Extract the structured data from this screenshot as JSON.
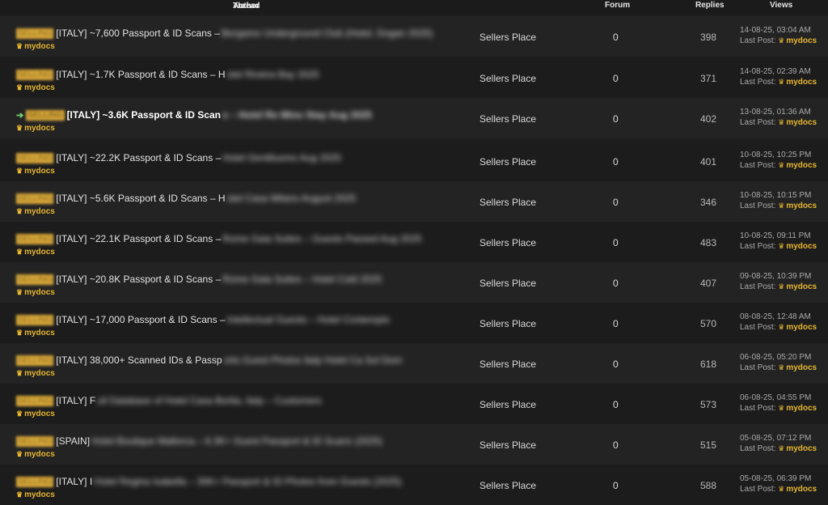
{
  "header": {
    "thread": "Thread",
    "author": "Author",
    "forum": "Forum",
    "replies": "Replies",
    "views": "Views"
  },
  "colors": {
    "accent": "#e8b730",
    "prefix_badge": "#d8a83a",
    "row_odd": "#232323",
    "row_even": "#1c1c1c",
    "new_arrow": "#6fd66f"
  },
  "rows": [
    {
      "prefix": "SELLING",
      "title": "[ITALY] ~7,600 Passport & ID Scans –",
      "hidden": "Bergamo Underground Club (Hotel, Dogan 2025)",
      "author": "mydocs",
      "forum": "Sellers Place",
      "count": "0",
      "replies": "398",
      "date": "14-08-25, 03:04 AM",
      "lp_label": "Last Post:",
      "lp_user": "mydocs"
    },
    {
      "prefix": "SELLING",
      "title": "[ITALY] ~1.7K Passport & ID Scans – H",
      "hidden": "otel Riviera Bay 2025",
      "author": "mydocs",
      "forum": "Sellers Place",
      "count": "0",
      "replies": "371",
      "date": "14-08-25, 02:39 AM",
      "lp_label": "Last Post:",
      "lp_user": "mydocs"
    },
    {
      "prefix": "SELLING",
      "title": "[ITALY] ~3.6K Passport & ID Scan",
      "hidden": "s – Hotel Re Mino Stay Aug 2025",
      "author": "mydocs",
      "forum": "Sellers Place",
      "count": "0",
      "replies": "402",
      "date": "13-08-25, 01:36 AM",
      "lp_label": "Last Post:",
      "lp_user": "mydocs"
    },
    {
      "prefix": "SELLING",
      "title": "[ITALY] ~22.2K Passport & ID Scans –",
      "hidden": "Hotel Gentiluomo Aug 2025",
      "author": "mydocs",
      "forum": "Sellers Place",
      "count": "0",
      "replies": "401",
      "date": "10-08-25, 10:25 PM",
      "lp_label": "Last Post:",
      "lp_user": "mydocs"
    },
    {
      "prefix": "SELLING",
      "title": "[ITALY] ~5.6K Passport & ID Scans – H",
      "hidden": "otel Casa Milano August 2025",
      "author": "mydocs",
      "forum": "Sellers Place",
      "count": "0",
      "replies": "346",
      "date": "10-08-25, 10:15 PM",
      "lp_label": "Last Post:",
      "lp_user": "mydocs"
    },
    {
      "prefix": "SELLING",
      "title": "[ITALY] ~22.1K Passport & ID Scans –",
      "hidden": "Rome Gaia Suites – Guests Passed Aug 2025",
      "author": "mydocs",
      "forum": "Sellers Place",
      "count": "0",
      "replies": "483",
      "date": "10-08-25, 09:11 PM",
      "lp_label": "Last Post:",
      "lp_user": "mydocs"
    },
    {
      "prefix": "SELLING",
      "title": "[ITALY] ~20.8K Passport & ID Scans –",
      "hidden": "Rome Gaia Suites – Hotel Cold 2025",
      "author": "mydocs",
      "forum": "Sellers Place",
      "count": "0",
      "replies": "407",
      "date": "09-08-25, 10:39 PM",
      "lp_label": "Last Post:",
      "lp_user": "mydocs"
    },
    {
      "prefix": "SELLING",
      "title": "[ITALY] ~17,000 Passport & ID Scans –",
      "hidden": "Intellectual Guests – Hotel Contemplo",
      "author": "mydocs",
      "forum": "Sellers Place",
      "count": "0",
      "replies": "570",
      "date": "08-08-25, 12:48 AM",
      "lp_label": "Last Post:",
      "lp_user": "mydocs"
    },
    {
      "prefix": "SELLING",
      "title": "[ITALY] 38,000+ Scanned IDs & Passp",
      "hidden": "orts Guest Photos Italy Hotel Ca Sol Dom",
      "author": "mydocs",
      "forum": "Sellers Place",
      "count": "0",
      "replies": "618",
      "date": "06-08-25, 05:20 PM",
      "lp_label": "Last Post:",
      "lp_user": "mydocs"
    },
    {
      "prefix": "SELLING",
      "title": "[ITALY] F",
      "hidden": "ull Database of Hotel Casa Bortia, Italy – Customers",
      "author": "mydocs",
      "forum": "Sellers Place",
      "count": "0",
      "replies": "573",
      "date": "06-08-25, 04:55 PM",
      "lp_label": "Last Post:",
      "lp_user": "mydocs"
    },
    {
      "prefix": "SELLING",
      "title": "[SPAIN]",
      "hidden": "Hotel Boutique Mallorca – 6.3K+ Guest Passport & ID Scans (2025)",
      "author": "mydocs",
      "forum": "Sellers Place",
      "count": "0",
      "replies": "515",
      "date": "05-08-25, 07:12 PM",
      "lp_label": "Last Post:",
      "lp_user": "mydocs"
    },
    {
      "prefix": "SELLING",
      "title": "[ITALY] I",
      "hidden": "Hotel Regina Isabella – 30K+ Passport & ID Photos from Guests (2025)",
      "author": "mydocs",
      "forum": "Sellers Place",
      "count": "0",
      "replies": "588",
      "date": "05-08-25, 06:39 PM",
      "lp_label": "Last Post:",
      "lp_user": "mydocs"
    }
  ]
}
